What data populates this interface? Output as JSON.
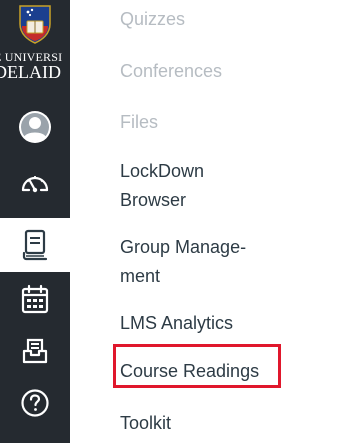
{
  "logo": {
    "line1": "E UNIVERSI",
    "line2": "DELAID"
  },
  "global_nav": {
    "items": [
      {
        "icon": "account-icon"
      },
      {
        "icon": "dashboard-icon"
      },
      {
        "icon": "courses-icon",
        "active": true
      },
      {
        "icon": "calendar-icon"
      },
      {
        "icon": "inbox-icon"
      },
      {
        "icon": "help-icon"
      }
    ]
  },
  "course_nav": {
    "items": [
      {
        "label": "Quizzes",
        "disabled": true
      },
      {
        "label": "Conferences",
        "disabled": true
      },
      {
        "label": "Files",
        "disabled": true
      },
      {
        "label_line1": "LockDown",
        "label_line2": "Browser"
      },
      {
        "label_line1": "Group Manage-",
        "label_line2": "ment"
      },
      {
        "label": "LMS Analytics"
      },
      {
        "label": "Course Readings",
        "highlighted": true
      },
      {
        "label": "Toolkit"
      }
    ]
  },
  "colors": {
    "nav_background": "#252a30",
    "text": "#2d3b45",
    "disabled_text": "#b6bcc2",
    "highlight": "#e0172c"
  }
}
